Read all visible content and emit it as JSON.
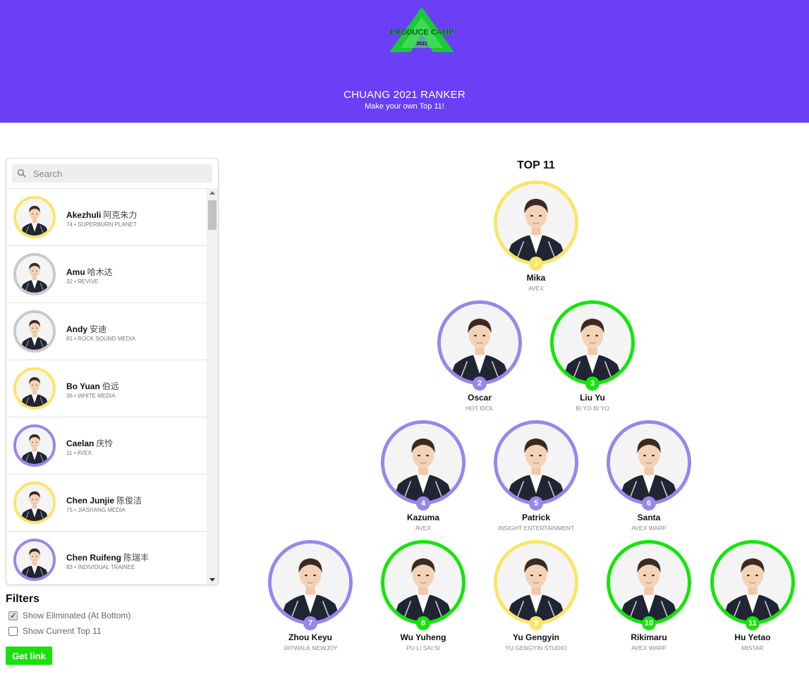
{
  "header": {
    "logo_text": "PRODUCE CAMP",
    "logo_year": "2021",
    "title": "CHUANG 2021 RANKER",
    "subtitle": "Make your own Top 11!",
    "bg_color": "#6a3ff5"
  },
  "search": {
    "placeholder": "Search",
    "icon": "search-icon"
  },
  "trainee_list": [
    {
      "name": "Akezhuli",
      "cn": "阿克朱力",
      "meta": "74 • SUPERBURN PLANET",
      "ring": "yellow"
    },
    {
      "name": "Amu",
      "cn": "哈木达",
      "meta": "32 • REVIVE",
      "ring": "gray"
    },
    {
      "name": "Andy",
      "cn": "安迪",
      "meta": "81 • ROCK SOUND MEDIA",
      "ring": "gray"
    },
    {
      "name": "Bo Yuan",
      "cn": "伯远",
      "meta": "36 • WHITE MEDIA",
      "ring": "yellow"
    },
    {
      "name": "Caelan",
      "cn": "庆怜",
      "meta": "11 • AVEX",
      "ring": "purple"
    },
    {
      "name": "Chen Junjie",
      "cn": "陈俊洁",
      "meta": "75 • JIASHANG MEDIA",
      "ring": "yellow"
    },
    {
      "name": "Chen Ruifeng",
      "cn": "陈瑞丰",
      "meta": "83 • INDIVIDUAL TRAINEE",
      "ring": "purple"
    }
  ],
  "filters": {
    "title": "Filters",
    "options": [
      {
        "label": "Show Eliminated (At Bottom)",
        "checked": true
      },
      {
        "label": "Show Current Top 11",
        "checked": false
      }
    ]
  },
  "get_link_label": "Get link",
  "top11": {
    "title": "TOP 11",
    "ranks": [
      {
        "rank": "1",
        "name": "Mika",
        "company": "AVEX",
        "ring": "yellow"
      },
      {
        "rank": "2",
        "name": "Oscar",
        "company": "HOT IDOL",
        "ring": "purple"
      },
      {
        "rank": "3",
        "name": "Liu Yu",
        "company": "BI YO BI YO",
        "ring": "green"
      },
      {
        "rank": "4",
        "name": "Kazuma",
        "company": "AVEX",
        "ring": "purple"
      },
      {
        "rank": "5",
        "name": "Patrick",
        "company": "INSIGHT ENTERTAINMENT",
        "ring": "purple"
      },
      {
        "rank": "6",
        "name": "Santa",
        "company": "AVEX WARP",
        "ring": "purple"
      },
      {
        "rank": "7",
        "name": "Zhou Keyu",
        "company": "JAYWALK NEWJOY",
        "ring": "purple"
      },
      {
        "rank": "8",
        "name": "Wu Yuheng",
        "company": "PU LI SAI SI",
        "ring": "green"
      },
      {
        "rank": "9",
        "name": "Yu Gengyin",
        "company": "YU GENGYIN STUDIO",
        "ring": "yellow"
      },
      {
        "rank": "10",
        "name": "Rikimaru",
        "company": "AVEX WARP",
        "ring": "green"
      },
      {
        "rank": "11",
        "name": "Hu Yetao",
        "company": "MISTAR",
        "ring": "green"
      }
    ]
  },
  "colors": {
    "yellow": "#fae56a",
    "purple": "#9a86ea",
    "green": "#14e509",
    "gray": "#c9c9c9",
    "button_green": "#19e10c"
  }
}
